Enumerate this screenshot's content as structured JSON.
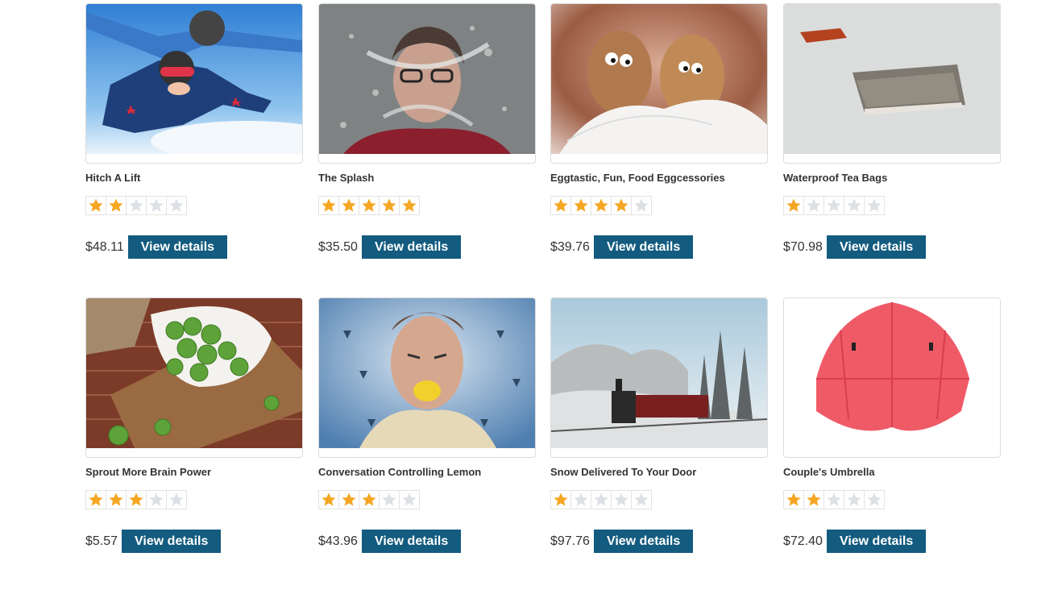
{
  "colors": {
    "button": "#135b7f",
    "star_on": "#f5a623",
    "star_off": "#dde1e5"
  },
  "products": [
    {
      "title": "Hitch A Lift",
      "rating": 2,
      "price": "$48.11",
      "button": "View details",
      "image": "skydivers-photo"
    },
    {
      "title": "The Splash",
      "rating": 5,
      "price": "$35.50",
      "button": "View details",
      "image": "water-splash-face-photo"
    },
    {
      "title": "Eggtastic, Fun, Food Eggcessories",
      "rating": 4,
      "price": "$39.76",
      "button": "View details",
      "image": "cartoon-eggs-photo"
    },
    {
      "title": "Waterproof Tea Bags",
      "rating": 1,
      "price": "$70.98",
      "button": "View details",
      "image": "tea-bag-photo"
    },
    {
      "title": "Sprout More Brain Power",
      "rating": 3,
      "price": "$5.57",
      "button": "View details",
      "image": "brussels-sprouts-photo"
    },
    {
      "title": "Conversation Controlling Lemon",
      "rating": 3,
      "price": "$43.96",
      "button": "View details",
      "image": "lemon-mouth-photo"
    },
    {
      "title": "Snow Delivered To Your Door",
      "rating": 1,
      "price": "$97.76",
      "button": "View details",
      "image": "snow-train-photo"
    },
    {
      "title": "Couple's Umbrella",
      "rating": 2,
      "price": "$72.40",
      "button": "View details",
      "image": "red-umbrella-photo"
    }
  ]
}
